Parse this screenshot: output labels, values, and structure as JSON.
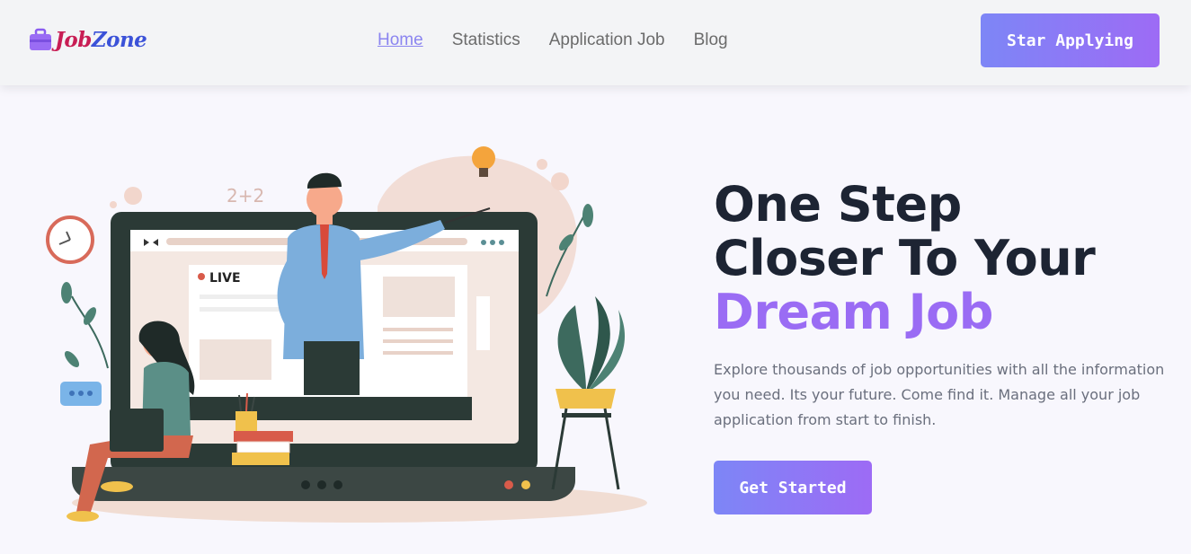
{
  "brand": {
    "logo_part1": "Job",
    "logo_part2": "Zone",
    "icon": "briefcase-icon"
  },
  "nav": {
    "items": [
      {
        "label": "Home",
        "active": true
      },
      {
        "label": "Statistics",
        "active": false
      },
      {
        "label": "Application Job",
        "active": false
      },
      {
        "label": "Blog",
        "active": false
      }
    ],
    "cta_label": "Star Applying"
  },
  "hero": {
    "title_line1": "One Step",
    "title_line2": "Closer To Your",
    "title_line3": "Dream Job",
    "description": "Explore thousands of job opportunities with all the information you need. Its your future. Come find it. Manage all your job application from start to finish.",
    "cta_label": "Get Started"
  },
  "illustration": {
    "live_badge": "LIVE",
    "math_note": "2+2"
  },
  "colors": {
    "accent": "#9a6cf4",
    "gradient_start": "#7d86f6",
    "gradient_end": "#9d6bf5",
    "heading": "#1d2433",
    "body_text": "#6a6f7d"
  }
}
